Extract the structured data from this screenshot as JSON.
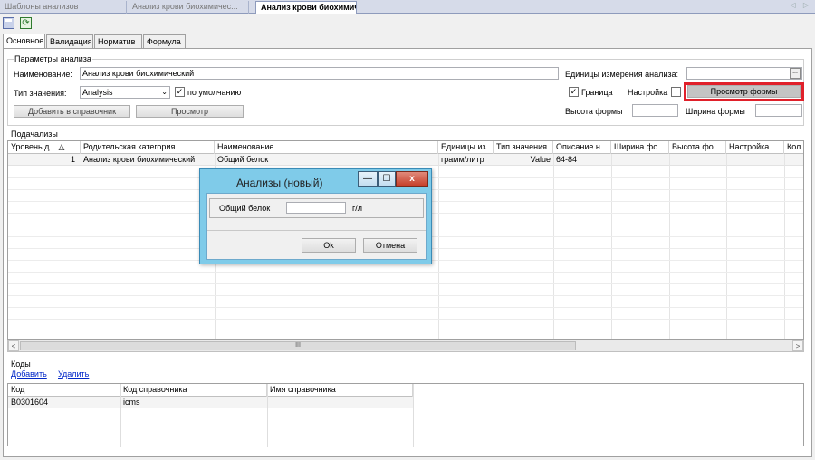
{
  "doc_tabs": [
    {
      "label": "Шаблоны анализов"
    },
    {
      "label": "Анализ  крови  биохимичес..."
    },
    {
      "label": "Анализ крови биохимиче...",
      "close": "×"
    }
  ],
  "doc_tab_nav": "◁ ▷",
  "icons": {
    "save": "save-icon",
    "refresh": "refresh-icon",
    "refresh_glyph": "⟳"
  },
  "tabs": [
    "Основное",
    "Валидация",
    "Норматив",
    "Формула"
  ],
  "params": {
    "title": "Параметры анализа",
    "name_label": "Наименование:",
    "name_value": "Анализ крови биохимический",
    "units_label": "Единицы измерения анализа:",
    "units_value": "",
    "units_button": "...",
    "type_label": "Тип значения:",
    "type_value": "Analysis",
    "type_arrow": "⌄",
    "default_check": "✓",
    "default_label": "по умолчанию",
    "border_check": "✓",
    "border_label": "Граница",
    "setup_label": "Настройка",
    "preview_form_button": "Просмотр формы",
    "add_ref_button": "Добавить в справочник",
    "preview_button": "Просмотр",
    "form_height_label": "Высота формы",
    "form_width_label": "Ширина формы"
  },
  "subanalyses": {
    "title": "Подачализы",
    "columns": [
      "Уровень д...",
      "Родительская категория",
      "Наименование",
      "Единицы из...",
      "Тип значения",
      "Описание н...",
      "Ширина фо...",
      "Высота фо...",
      "Настройка ...",
      "Кол"
    ],
    "sort_glyph": "△",
    "rows": [
      {
        "level": "1",
        "parent": "Анализ крови биохимический",
        "name": "Общий белок",
        "units": "грамм/литр",
        "type": "Value",
        "desc": "64-84"
      }
    ],
    "scroll_left": "<",
    "scroll_right": ">",
    "scroll_thumb": "III"
  },
  "codes": {
    "title": "Коды",
    "add_link": "Добавить",
    "delete_link": "Удалить",
    "columns": [
      "Код",
      "Код справочника",
      "Имя справочника"
    ],
    "rows": [
      {
        "code": "B0301604",
        "ref_code": "icms",
        "ref_name": ""
      }
    ]
  },
  "dialog": {
    "title": "Анализы (новый)",
    "minimize": "—",
    "maximize": "☐",
    "close": "x",
    "field_label": "Общий белок",
    "field_value": "",
    "field_unit": "г/л",
    "ok": "Ok",
    "cancel": "Отмена"
  }
}
